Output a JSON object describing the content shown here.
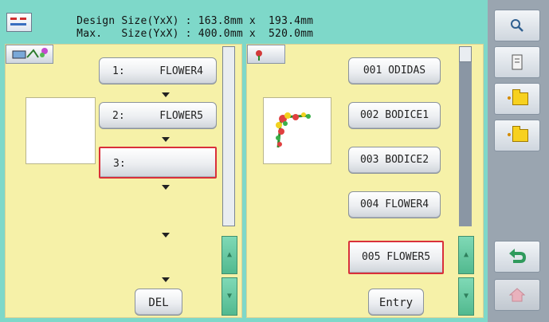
{
  "header": {
    "line1_label": "Design Size(YxX)",
    "line1_colon": ":",
    "line1_y": "163.8mm",
    "line1_x": "x",
    "line1_x_val": "193.4mm",
    "line2_label": "Max.   Size(YxX)",
    "line2_colon": ":",
    "line2_y": "400.0mm",
    "line2_x": "x",
    "line2_x_val": "520.0mm",
    "icon": "design-layout-icon"
  },
  "left_panel": {
    "slots": [
      {
        "num": "1:",
        "name": "FLOWER4"
      },
      {
        "num": "2:",
        "name": "FLOWER5"
      },
      {
        "num": "3:",
        "name": ""
      }
    ],
    "del_label": "DEL",
    "icon": "combine-editor-icon"
  },
  "right_panel": {
    "patterns": [
      "001 ODIDAS",
      "002 BODICE1",
      "003 BODICE2",
      "004 FLOWER4",
      "005 FLOWER5"
    ],
    "selected_index": 4,
    "entry_label": "Entry",
    "icon": "flower-marker-icon"
  },
  "toolbar": {
    "icons": [
      "zoom-icon",
      "memory-icon",
      "folder-back-icon",
      "folder-next-icon",
      "return-icon",
      "home-icon"
    ]
  },
  "colors": {
    "background": "#7ed8c9",
    "panel": "#f6f1a8",
    "selected_border": "#d9303a",
    "toolbar": "#9aa5b0"
  }
}
